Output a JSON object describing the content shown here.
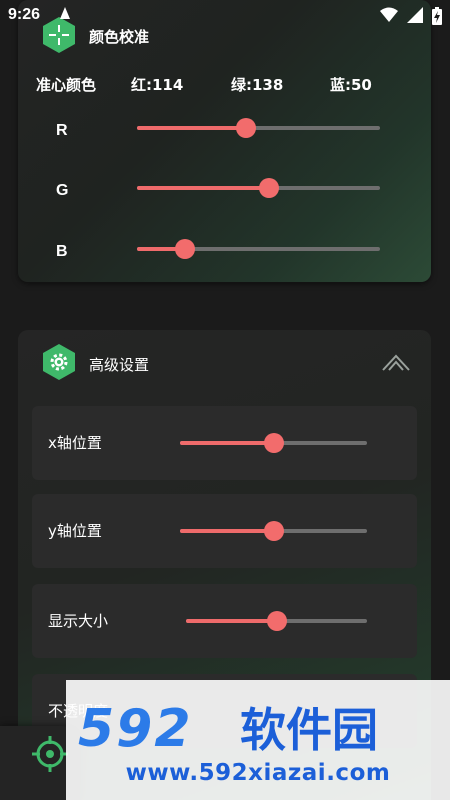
{
  "status_bar": {
    "time": "9:26",
    "icons": [
      "notification-icon",
      "wifi-icon",
      "signal-icon",
      "battery-icon"
    ]
  },
  "colors": {
    "accent_slider": "#ef6b6b",
    "hex_badge": "#3fb96a"
  },
  "color_card": {
    "title": "颜色校准",
    "icon": "crosshair-icon",
    "header": {
      "crosshair_color_label": "准心颜色",
      "red": "红:114",
      "green": "绿:138",
      "blue": "蓝:50"
    },
    "channels": [
      {
        "label": "R",
        "value": 114,
        "max": 255
      },
      {
        "label": "G",
        "value": 138,
        "max": 255
      },
      {
        "label": "B",
        "value": 50,
        "max": 255
      }
    ]
  },
  "advanced_card": {
    "title": "高级设置",
    "icon": "gear-icon",
    "collapse_icon": "collapse-up-icon",
    "settings": [
      {
        "label": "x轴位置",
        "value": 0.5
      },
      {
        "label": "y轴位置",
        "value": 0.5
      },
      {
        "label": "显示大小",
        "value": 0.5
      },
      {
        "label": "不透明度"
      }
    ]
  },
  "fab": {
    "icon": "crosshair-target-icon"
  },
  "watermark": {
    "brand": "592软件园",
    "url": "www.592xiazai.com"
  }
}
